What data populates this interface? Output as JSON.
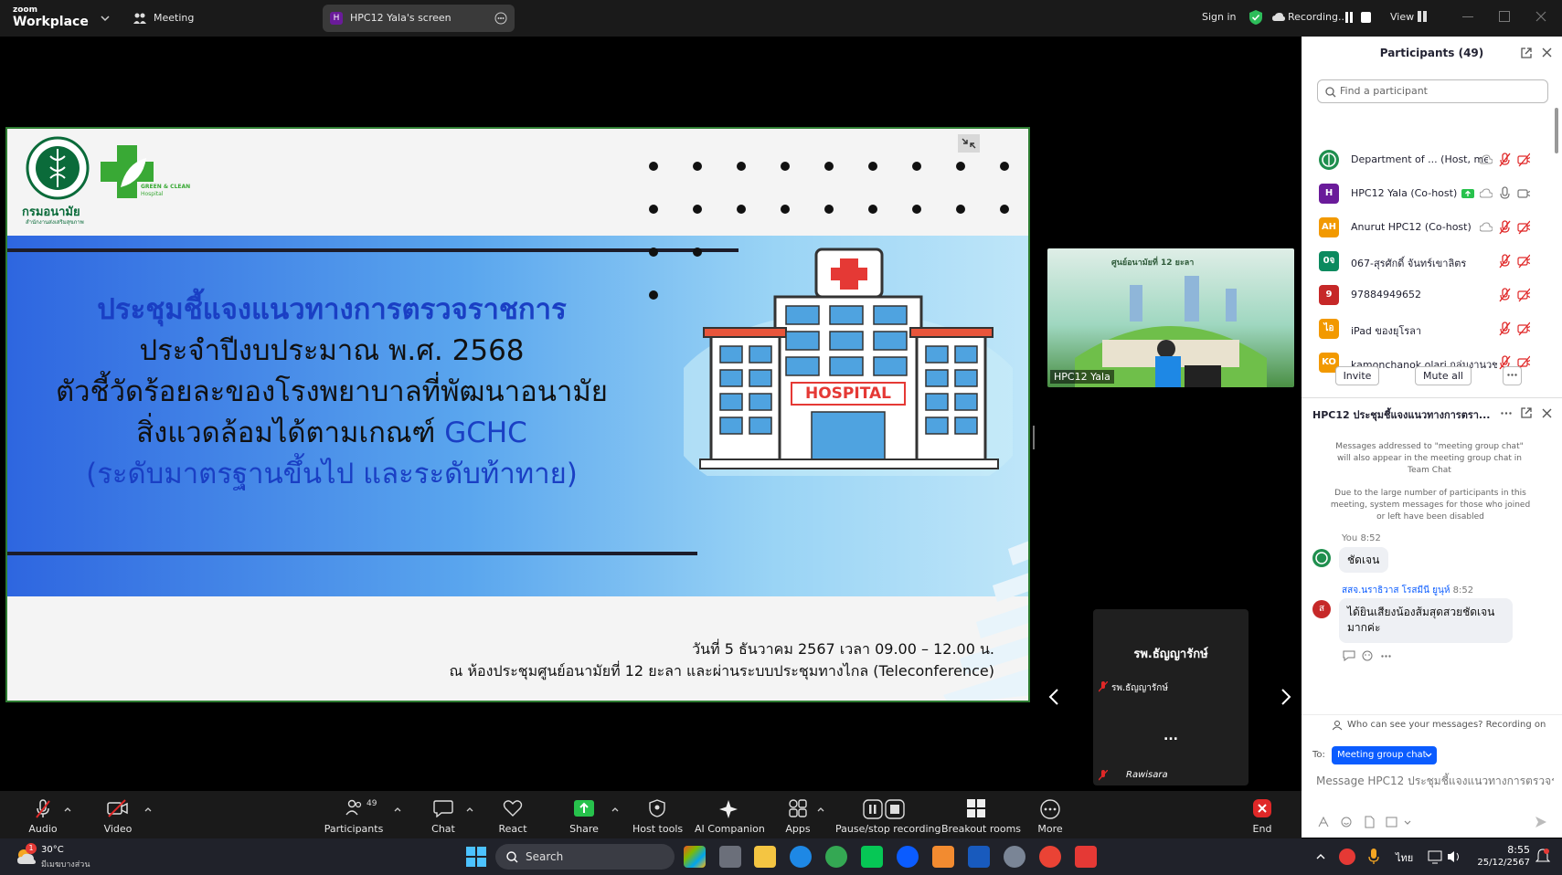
{
  "topbar": {
    "brand_small": "zoom",
    "brand_big": "Workplace",
    "meeting_label": "Meeting",
    "share_tab_initial": "H",
    "share_tab_label": "HPC12 Yala's screen",
    "sign_in": "Sign in",
    "recording": "Recording...",
    "view": "View"
  },
  "slide": {
    "logo1_text": "กรมอนามัย",
    "logo1_sub": "สำนักงานส่งเสริมสุขภาพ",
    "logo2_line1": "GREEN & CLEAN",
    "logo2_line2": "Hospital",
    "title_line1": "ประชุมชี้แจงแนวทางการตรวจราชการ",
    "title_line2": "ประจำปีงบประมาณ พ.ศ. 2568",
    "title_line3": "ตัวชี้วัดร้อยละของโรงพยาบาลที่พัฒนาอนามัย",
    "title_line4_a": "สิ่งแวดล้อมได้ตามเกณฑ์",
    "title_line4_b": "GCHC",
    "title_line5": "(ระดับมาตรฐานขึ้นไป และระดับท้าทาย)",
    "hospital_sign": "HOSPITAL",
    "date_line": "วันที่ 5 ธันวาคม 2567 เวลา 09.00 – 12.00 น.",
    "venue_line": "ณ ห้องประชุมศูนย์อนามัยที่ 12 ยะลา และผ่านระบบประชุมทางไกล (Teleconference)"
  },
  "video": {
    "tile_label": "HPC12 Yala",
    "tile_header": "ศูนย์อนามัยที่ 12 ยะลา",
    "small_tile_title": "รพ.ธัญญารักษ์",
    "small_tile_name": "รพ.ธัญญารักษ์",
    "small_tile_dots": "...",
    "small_tile_bottom": "Rawisara"
  },
  "participants": {
    "title": "Participants (49)",
    "search_placeholder": "Find a participant",
    "rows": [
      {
        "initials": "",
        "name": "Department of ... (Host, me)",
        "color": "#1f8f4e"
      },
      {
        "initials": "H",
        "name": "HPC12 Yala (Co-host)",
        "color": "#6a1b9a"
      },
      {
        "initials": "AH",
        "name": "Anurut HPC12 (Co-host)",
        "color": "#f29900"
      },
      {
        "initials": "0จ",
        "name": "067-สุรศักดิ์ จันทร์เขาลิตร",
        "color": "#0b8a5f"
      },
      {
        "initials": "9",
        "name": "97884949652",
        "color": "#c62828"
      },
      {
        "initials": "ไอ",
        "name": "iPad ของยุโรลา",
        "color": "#f29900"
      },
      {
        "initials": "KO",
        "name": "kamonchanok olari กลุ่มงานวชก...",
        "color": "#f29900"
      }
    ],
    "invite": "Invite",
    "mute_all": "Mute all"
  },
  "chat": {
    "title": "HPC12 ประชุมชี้แจงแนวทางการตรา...",
    "notice1": "Messages addressed to \"meeting group chat\" will also appear in the meeting group chat in Team Chat",
    "notice2": "Due to the large number of participants in this meeting, system messages for those who joined or left have been disabled",
    "msg1_sender": "You",
    "msg1_time": "8:52",
    "msg1_text": "ชัดเจน",
    "msg2_initial": "ส",
    "msg2_sender": "สสจ.นราธิวาส โรสมีนี ยูนุห์",
    "msg2_time": "8:52",
    "msg2_text": "ได้ยินเสียงน้องส้มสุดสวยชัดเจนมากค่ะ",
    "who_can_see": "Who can see your messages? Recording on",
    "to_label": "To:",
    "to_value": "Meeting group chat",
    "input_placeholder": "Message HPC12 ประชุมชี้แจงแนวทางการตรวจร..."
  },
  "toolbar": {
    "audio": "Audio",
    "video": "Video",
    "participants": "Participants",
    "participants_count": "49",
    "chat": "Chat",
    "react": "React",
    "share": "Share",
    "host_tools": "Host tools",
    "ai": "AI Companion",
    "apps": "Apps",
    "pause_rec": "Pause/stop recording",
    "breakout": "Breakout rooms",
    "more": "More",
    "end": "End"
  },
  "taskbar": {
    "temp": "30°C",
    "weather": "มีเมฆบางส่วน",
    "weather_badge": "1",
    "search": "Search",
    "lang": "ไทย",
    "time": "8:55",
    "date": "25/12/2567"
  }
}
